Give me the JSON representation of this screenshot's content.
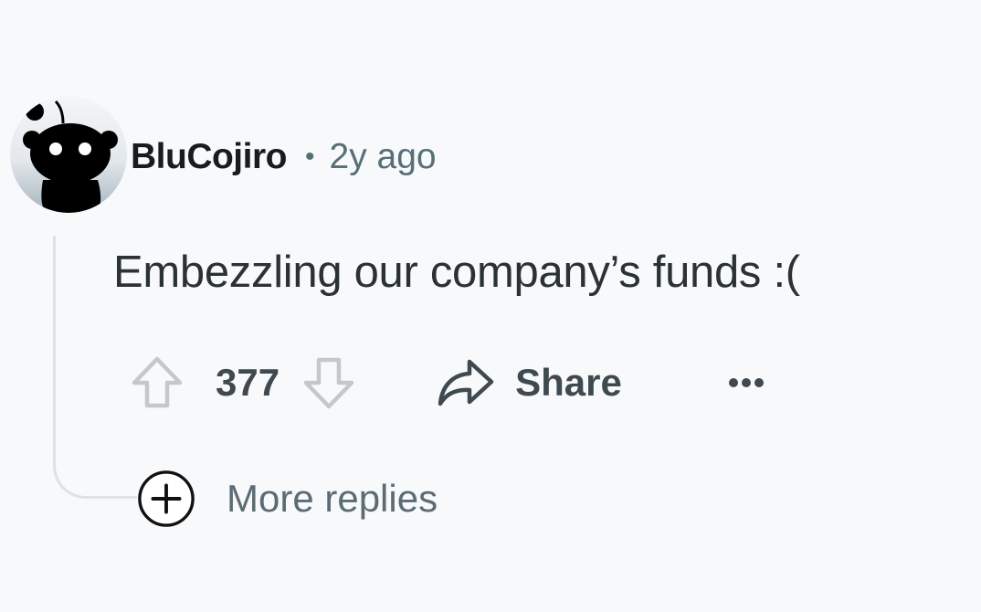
{
  "comment": {
    "author": "BluCojiro",
    "separator": "•",
    "timestamp": "2y ago",
    "body": "Embezzling our company’s funds :(",
    "avatar_icon": "snoo-avatar-icon",
    "actions": {
      "upvote_icon": "upvote-arrow-icon",
      "score": "377",
      "downvote_icon": "downvote-arrow-icon",
      "share_icon": "share-arrow-icon",
      "share_label": "Share",
      "more_icon": "ellipsis-icon"
    },
    "more_replies": {
      "icon": "plus-circle-icon",
      "label": "More replies"
    }
  },
  "colors": {
    "background": "#f8f9fb",
    "author": "#181c1f",
    "meta": "#576f76",
    "body_text": "#2a3236",
    "action_text": "#3e4a50",
    "thread_line": "#dde2e7"
  }
}
